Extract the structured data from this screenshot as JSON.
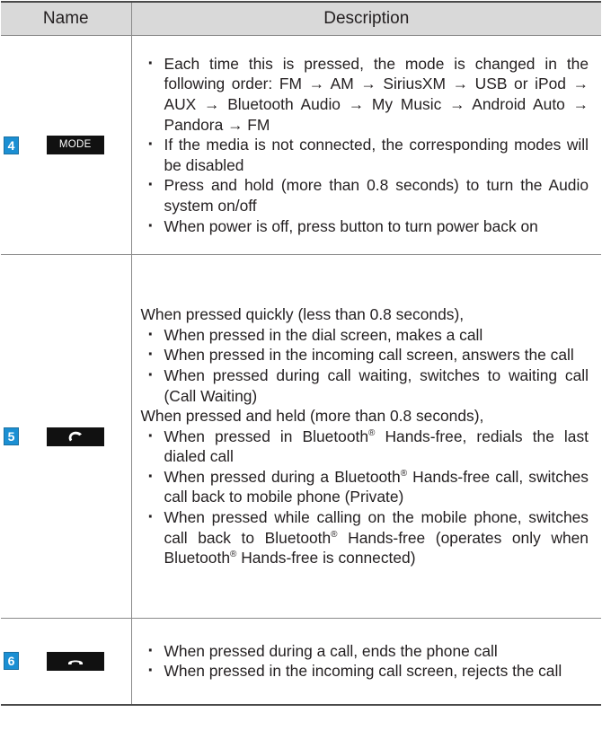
{
  "header": {
    "name_label": "Name",
    "description_label": "Description"
  },
  "rows": [
    {
      "number": "4",
      "button_label": "MODE",
      "button_icon": "text-label",
      "intro": "",
      "items": [
        "Each time this is pressed, the mode is changed in the following order: FM → AM → SiriusXM → USB or iPod → AUX → Bluetooth Audio → My Music → Android Auto → Pandora → FM",
        "If the media is not connected, the corresponding modes will be disabled",
        "Press and hold (more than 0.8 seconds) to turn the Audio system on/off",
        "When power is off, press button to turn power back on"
      ]
    },
    {
      "number": "5",
      "button_icon": "call-answer-icon",
      "intro_quick": "When pressed quickly (less than 0.8 seconds),",
      "quick_items": [
        "When pressed in the dial screen, makes a call",
        "When pressed in the incoming call screen, answers the call",
        "When pressed during call waiting, switches to waiting call (Call Waiting)"
      ],
      "intro_held": "When pressed and held (more than 0.8 seconds),",
      "held_items": [
        {
          "a": "When pressed in Bluetooth",
          "sup": "®",
          "b": " Hands-free, redials the last dialed call"
        },
        {
          "a": "When pressed during a Bluetooth",
          "sup": "®",
          "b": " Hands-free call, switches call back to mobile phone (Private)"
        },
        {
          "a": "When pressed while calling on the mobile phone, switches call back to Bluetooth",
          "sup": "®",
          "b": " Hands-free (operates only when Bluetooth",
          "sup2": "®",
          "c": " Hands-free is connected)"
        }
      ]
    },
    {
      "number": "6",
      "button_icon": "call-end-icon",
      "items": [
        "When pressed during a call, ends the phone call",
        "When pressed in the incoming call screen, rejects the call"
      ]
    }
  ],
  "colors": {
    "badge": "#1b8fd3",
    "header_bg": "#d9d9d9",
    "keycap": "#111111"
  }
}
